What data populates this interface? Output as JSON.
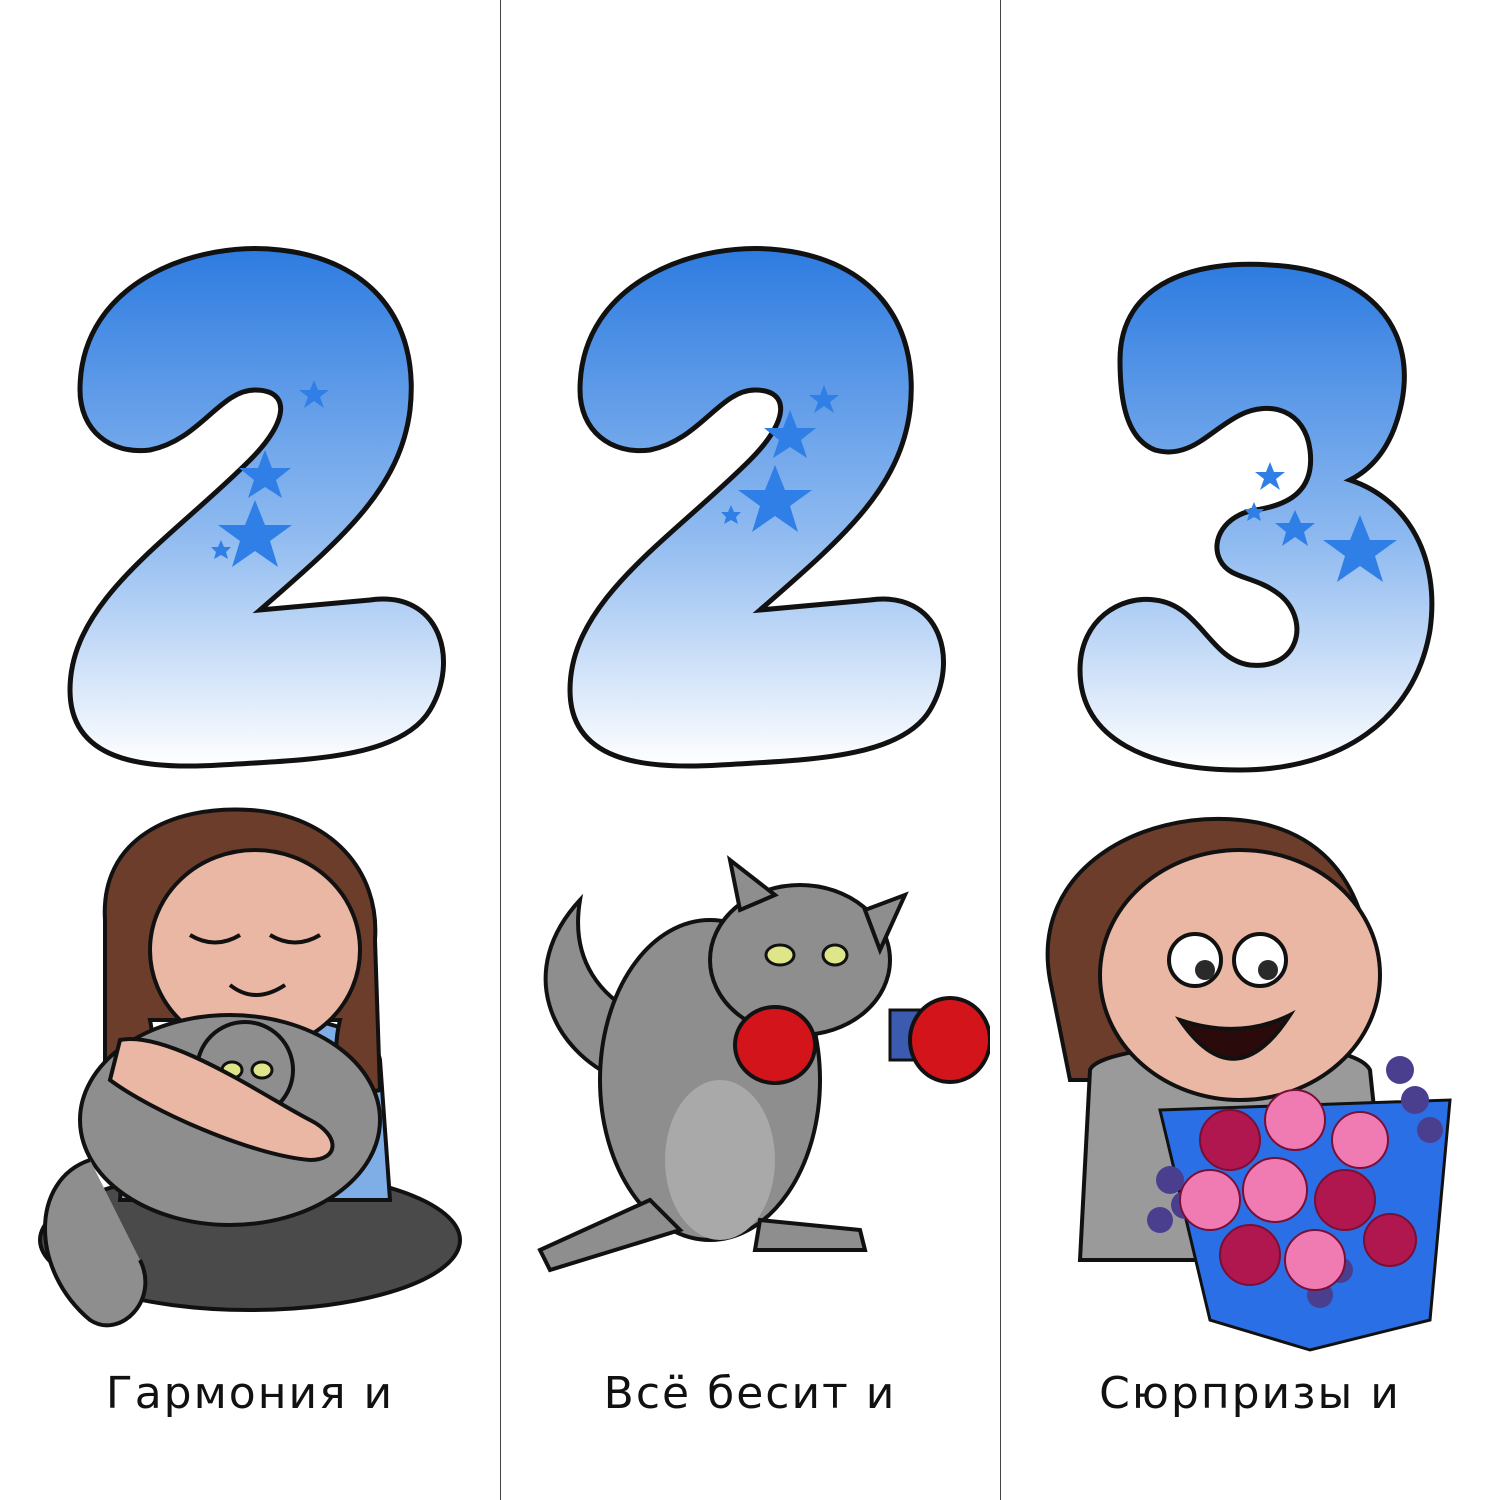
{
  "panels": [
    {
      "digit": "2",
      "caption": "Гармония и"
    },
    {
      "digit": "2",
      "caption": "Всё бесит и"
    },
    {
      "digit": "3",
      "caption": "Сюрпризы и"
    }
  ],
  "colors": {
    "digit_top": "#2d7be0",
    "digit_bottom": "#ffffff",
    "star": "#2f7fe6",
    "cat_fur": "#8e8e8e",
    "hair": "#6b3d2a",
    "skin": "#e9b7a3",
    "shirt": "#7faee6",
    "glove": "#d3151b",
    "rose_pink": "#f07bb2",
    "rose_dark": "#b0174f",
    "lilac": "#4a3f8f",
    "wrap": "#2a6fe6"
  }
}
